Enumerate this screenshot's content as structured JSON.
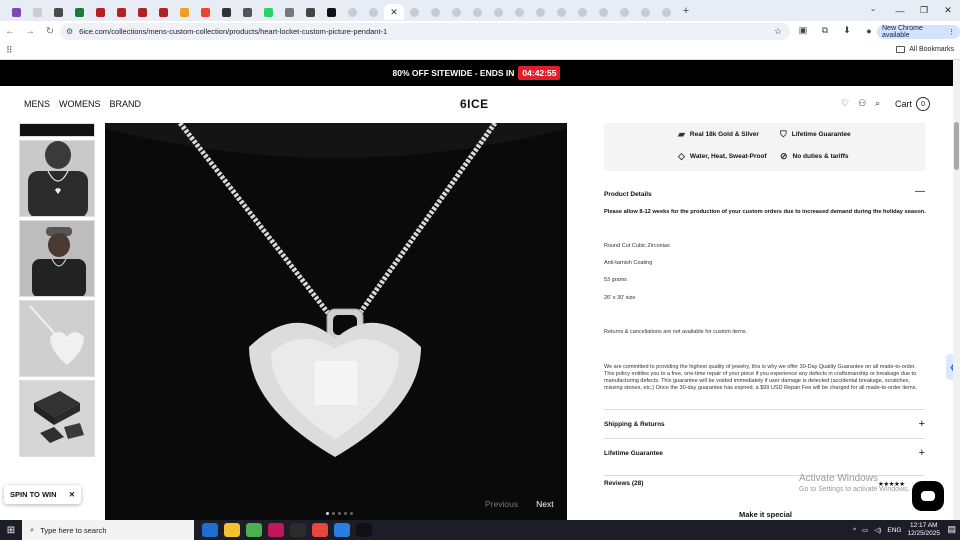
{
  "browser": {
    "tab_favicon_colors": [
      "#7b4ab8",
      "#cccccc",
      "#4a4a4a",
      "#1e7a3a",
      "#b22222",
      "#b22222",
      "#b22222",
      "#b22222",
      "#f0a020",
      "#ea4335",
      "#333333",
      "#555555",
      "#25d366",
      "#777777",
      "#444444",
      "#111111"
    ],
    "active_tab_close": "✕",
    "new_tab_icon": "+",
    "window_controls": {
      "minimize": "—",
      "restore": "❐",
      "close": "✕"
    },
    "url": "6ice.com/collections/mens-custom-collection/products/heart-locket-custom-picture-pendant-1",
    "new_chrome_label": "New Chrome available",
    "all_bookmarks_label": "All Bookmarks"
  },
  "promo": {
    "text": "80% OFF SITEWIDE - ENDS IN",
    "timer": "04:42:55"
  },
  "header": {
    "nav": [
      "MENS",
      "WOMENS",
      "BRAND"
    ],
    "logo": "6ICE",
    "cart_label": "Cart",
    "cart_count": "0"
  },
  "gallery": {
    "prev_label": "Previous",
    "next_label": "Next",
    "dot_count": 5,
    "active_dot": 0
  },
  "features": [
    {
      "icon": "gold-icon",
      "label": "Real 18k Gold & Silver"
    },
    {
      "icon": "shield-icon",
      "label": "Lifetime Guarantee"
    },
    {
      "icon": "diamond-icon",
      "label": "Water, Heat, Sweat-Proof"
    },
    {
      "icon": "no-duties-icon",
      "label": "No duties & tariffs"
    }
  ],
  "details": {
    "title": "Product Details",
    "notice": "Please allow 8-12 weeks for the production of your custom orders due to increased demand during the holiday season.",
    "specs": [
      "Round Cut Cubic Zirconias",
      "Anti-tarnish Coating",
      "53 grams",
      "26' x 30' size"
    ],
    "returns": "Returns & cancellations are not available for custom items.",
    "guarantee": "We are committed to providing the highest quality of jewelry, this is why we offer 30-Day Quality Guarantee on all made-to-order. This policy entitles you to a free, one-time repair of your piece if you experience any defects in craftsmanship or breakage due to manufacturing defects. This guarantee will be voided immediately if user damage is detected (accidental breakage, scratches, missing stones, etc.) Once the 30-day guarantee has expired, a $99 USD Repair Fee will be charged for all made-to-order items."
  },
  "accordions": {
    "shipping": "Shipping & Returns",
    "lifetime": "Lifetime Guarantee",
    "reviews": "Reviews",
    "reviews_count": "(28)"
  },
  "make_it_special": "Make it special",
  "spin_to_win": "SPIN TO WIN",
  "windows_watermark": {
    "line1": "Activate Windows",
    "line2": "Go to Settings to activate Windows."
  },
  "taskbar": {
    "search_placeholder": "Type here to search",
    "lang": "ENG",
    "time": "12:17 AM",
    "date": "12/25/2025",
    "app_colors": [
      "#1f6fd1",
      "#f2c230",
      "#4caf50",
      "#c2185b",
      "#2c2c2c",
      "#e8453c",
      "#2a7de1",
      "#111111"
    ]
  }
}
